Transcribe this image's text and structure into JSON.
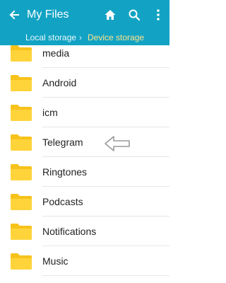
{
  "header": {
    "title": "My Files",
    "back_icon": "arrow-left-icon",
    "actions": [
      "home-icon",
      "search-icon",
      "more-vert-icon"
    ],
    "background": "#12a3c4"
  },
  "breadcrumb": {
    "items": [
      "Local storage",
      "Device storage"
    ],
    "separator": "›",
    "current_color": "#ffe38a"
  },
  "folders": [
    {
      "name": "media"
    },
    {
      "name": "Android"
    },
    {
      "name": "icm"
    },
    {
      "name": "Telegram"
    },
    {
      "name": "Ringtones"
    },
    {
      "name": "Podcasts"
    },
    {
      "name": "Notifications"
    },
    {
      "name": "Music"
    }
  ],
  "folder_color": "#f7c21a",
  "annotation": {
    "icon": "hollow-arrow-left-icon",
    "points_to": "Telegram"
  }
}
